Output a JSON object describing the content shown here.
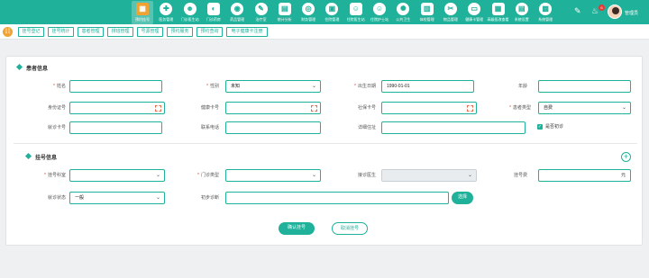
{
  "top_nav": {
    "items": [
      {
        "label": "预约挂号",
        "icon": "calendar-icon",
        "glyph": "▦",
        "active": true
      },
      {
        "label": "医务管理",
        "icon": "stethoscope-icon",
        "glyph": "✚"
      },
      {
        "label": "门诊医生站",
        "icon": "doctor-icon",
        "glyph": "☻"
      },
      {
        "label": "门诊药房",
        "icon": "pill-icon",
        "glyph": "◐"
      },
      {
        "label": "药品管理",
        "icon": "medicine-icon",
        "glyph": "◉"
      },
      {
        "label": "治疗室",
        "icon": "treatment-icon",
        "glyph": "✎"
      },
      {
        "label": "统计分析",
        "icon": "stats-icon",
        "glyph": "▤"
      },
      {
        "label": "财务管理",
        "icon": "finance-icon",
        "glyph": "◎"
      },
      {
        "label": "住院管理",
        "icon": "bed-icon",
        "glyph": "▣"
      },
      {
        "label": "住院医生站",
        "icon": "ward-doctor-icon",
        "glyph": "☺"
      },
      {
        "label": "住院护士站",
        "icon": "nurse-icon",
        "glyph": "☺"
      },
      {
        "label": "公共卫生",
        "icon": "public-health-icon",
        "glyph": "✺"
      },
      {
        "label": "体检管理",
        "icon": "exam-icon",
        "glyph": "▥"
      },
      {
        "label": "物品管理",
        "icon": "goods-icon",
        "glyph": "✂"
      },
      {
        "label": "健康卡管理",
        "icon": "health-card-icon",
        "glyph": "▭"
      },
      {
        "label": "高级医改查看",
        "icon": "report-icon",
        "glyph": "▦"
      },
      {
        "label": "系统设置",
        "icon": "settings-icon",
        "glyph": "▤"
      },
      {
        "label": "系统管理",
        "icon": "admin-icon",
        "glyph": "▩"
      }
    ],
    "bell_count": "6",
    "user_name": "管理员"
  },
  "tabs": [
    {
      "label": "挂号登记",
      "active": true
    },
    {
      "label": "挂号统计"
    },
    {
      "label": "患者管理"
    },
    {
      "label": "排班管理"
    },
    {
      "label": "号源管理"
    },
    {
      "label": "预约服务"
    },
    {
      "label": "预约查询"
    },
    {
      "label": "电子健康卡注册"
    }
  ],
  "patient_info": {
    "title": "患者信息",
    "name_label": "姓名",
    "name_value": "",
    "gender_label": "性别",
    "gender_value": "未知",
    "birth_label": "出生日期",
    "birth_value": "1990-01-01",
    "age_label": "年龄",
    "age_value": "",
    "id_label": "身份证号",
    "health_card_label": "健康卡号",
    "social_card_label": "社保卡号",
    "patient_type_label": "患者类型",
    "patient_type_value": "自费",
    "visit_card_label": "就诊卡号",
    "phone_label": "联系电话",
    "address_label": "详细住址",
    "checkbox_label": "是否初诊"
  },
  "registration_info": {
    "title": "挂号信息",
    "dept_label": "挂号科室",
    "clinic_type_label": "门诊类型",
    "doctor_label": "接诊医生",
    "fee_label": "挂号费",
    "fee_unit": "元",
    "status_label": "就诊状态",
    "status_value": "一般",
    "diagnosis_label": "初步诊断",
    "select_button": "选择"
  },
  "actions": {
    "confirm": "确认挂号",
    "cancel": "取消挂号"
  },
  "colors": {
    "primary": "#1fb19a",
    "accent": "#f0a232",
    "required": "#e53935"
  }
}
